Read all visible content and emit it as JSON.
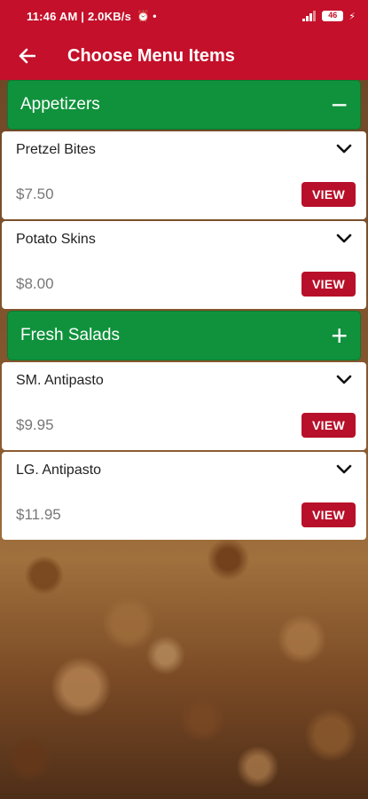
{
  "status_bar": {
    "time": "11:46 AM | 2.0KB/s",
    "battery": "46"
  },
  "app_bar": {
    "title": "Choose Menu Items"
  },
  "categories": [
    {
      "name": "Appetizers",
      "toggle": "−",
      "items": [
        {
          "name": "Pretzel Bites",
          "price": "$7.50",
          "button": "VIEW"
        },
        {
          "name": "Potato Skins",
          "price": "$8.00",
          "button": "VIEW"
        }
      ]
    },
    {
      "name": "Fresh Salads",
      "toggle": "+",
      "items": [
        {
          "name": "SM. Antipasto",
          "price": "$9.95",
          "button": "VIEW"
        },
        {
          "name": "LG. Antipasto",
          "price": "$11.95",
          "button": "VIEW"
        }
      ]
    }
  ],
  "colors": {
    "brand_red": "#c4102a",
    "category_green": "#10923c",
    "button_red": "#b8102a"
  }
}
